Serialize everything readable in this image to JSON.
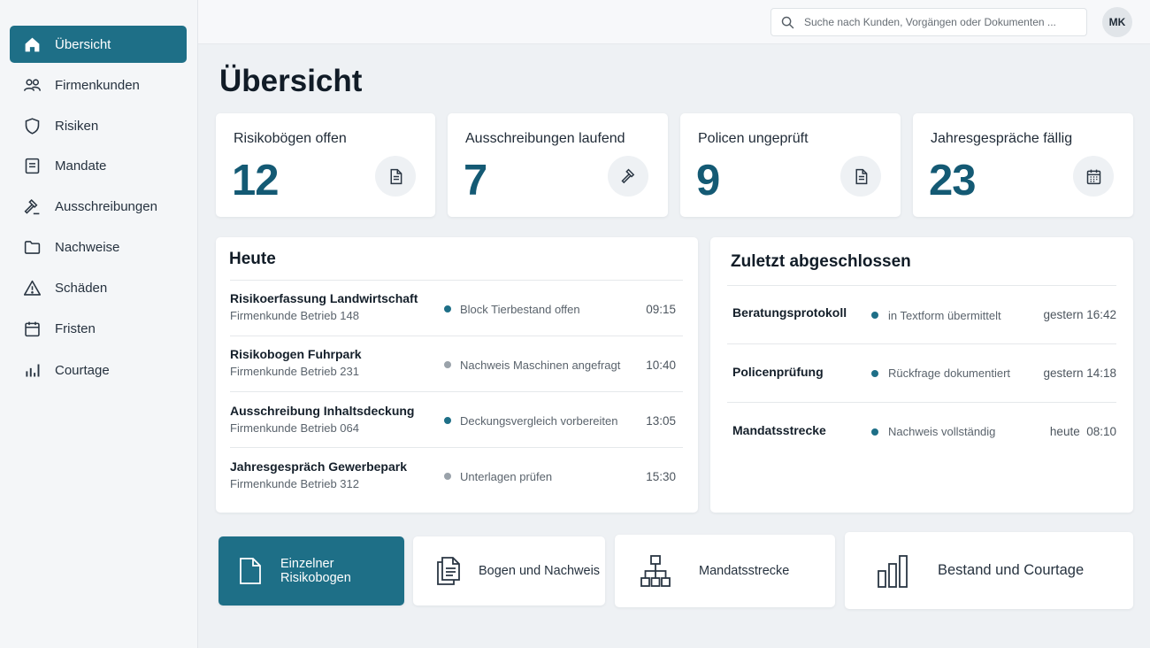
{
  "sidebar": {
    "items": [
      {
        "label": "Übersicht",
        "icon": "home-icon"
      },
      {
        "label": "Firmenkunden",
        "icon": "users-icon"
      },
      {
        "label": "Risiken",
        "icon": "shield-icon"
      },
      {
        "label": "Mandate",
        "icon": "document-icon"
      },
      {
        "label": "Ausschreibungen",
        "icon": "gavel-icon"
      },
      {
        "label": "Nachweise",
        "icon": "folder-icon"
      },
      {
        "label": "Schäden",
        "icon": "warning-icon"
      },
      {
        "label": "Fristen",
        "icon": "calendar-icon"
      },
      {
        "label": "Courtage",
        "icon": "bar-chart-icon"
      }
    ]
  },
  "topbar": {
    "search_placeholder": "Suche nach Kunden, Vorgängen oder Dokumenten ...",
    "avatar_initials": "MK"
  },
  "page": {
    "title": "Übersicht"
  },
  "kpis": [
    {
      "label": "Risikobögen offen",
      "value": "12",
      "icon": "document-icon"
    },
    {
      "label": "Ausschreibungen laufend",
      "value": "7",
      "icon": "gavel-icon"
    },
    {
      "label": "Policen ungeprüft",
      "value": "9",
      "icon": "document-icon"
    },
    {
      "label": "Jahresgespräche fällig",
      "value": "23",
      "icon": "calendar-icon"
    }
  ],
  "today": {
    "title": "Heute",
    "rows": [
      {
        "title": "Risikoerfassung Landwirtschaft",
        "sub": "Firmenkunde Betrieb 148",
        "status": "Block Tierbestand offen",
        "time": "09:15",
        "dot_color": "#1e6f87"
      },
      {
        "title": "Risikobogen Fuhrpark",
        "sub": "Firmenkunde Betrieb 231",
        "status": "Nachweis Maschinen angefragt",
        "time": "10:40",
        "dot_color": "#9aa2aa"
      },
      {
        "title": "Ausschreibung Inhaltsdeckung",
        "sub": "Firmenkunde Betrieb 064",
        "status": "Deckungsvergleich vorbereiten",
        "time": "13:05",
        "dot_color": "#1e6f87"
      },
      {
        "title": "Jahresgespräch Gewerbepark",
        "sub": "Firmenkunde Betrieb 312",
        "status": "Unterlagen prüfen",
        "time": "15:30",
        "dot_color": "#9aa2aa"
      }
    ]
  },
  "recent": {
    "title": "Zuletzt abgeschlossen",
    "rows": [
      {
        "title": "Beratungsprotokoll",
        "status": "in Textform übermittelt",
        "time": "gestern 16:42",
        "dot_color": "#1e6f87"
      },
      {
        "title": "Policenprüfung",
        "status": "Rückfrage dokumentiert",
        "time": "gestern 14:18",
        "dot_color": "#1e6f87"
      },
      {
        "title": "Mandatsstrecke",
        "status": "Nachweis vollständig",
        "time": "heute  08:10",
        "dot_color": "#1e6f87"
      }
    ]
  },
  "actions": [
    {
      "label": "Einzelner Risikobogen",
      "icon": "file-icon"
    },
    {
      "label": "Bogen und Nachweis",
      "icon": "files-icon"
    },
    {
      "label": "Mandatsstrecke",
      "icon": "sitemap-icon"
    },
    {
      "label": "Bestand und Courtage",
      "icon": "bar-chart-icon"
    }
  ],
  "colors": {
    "accent": "#1e6f87",
    "kpi_value": "#145a74",
    "muted_dot": "#9aa2aa"
  }
}
